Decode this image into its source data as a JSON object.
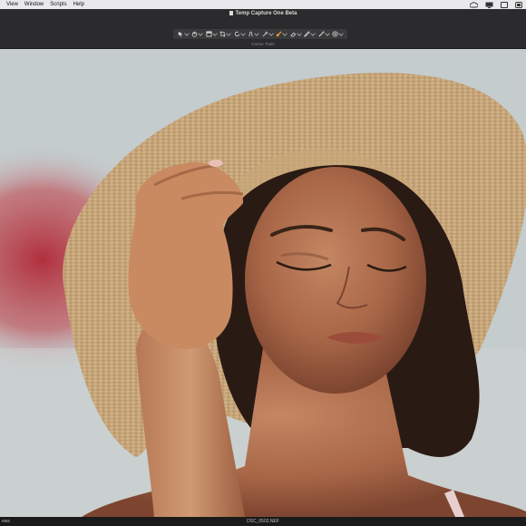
{
  "menu": {
    "items": [
      "View",
      "Window",
      "Scripts",
      "Help"
    ]
  },
  "window": {
    "title": "Temp Capture One Beta"
  },
  "toolbar": {
    "label": "Cursor Tools",
    "tools": [
      "pointer-tool-icon",
      "pan-tool-icon",
      "loupe-tool-icon",
      "crop-tool-icon",
      "rotate-tool-icon",
      "keystone-tool-icon",
      "picker-tool-icon",
      "brush-tool-icon",
      "eraser-tool-icon",
      "draw-mask-icon",
      "pen-tool-icon",
      "annotate-tool-icon"
    ]
  },
  "viewer": {
    "filename": "DSC_0502.NEF",
    "left_fragment": "ews"
  },
  "colors": {
    "accent": "#f0a030",
    "chrome": "#2b2b2d",
    "menubar": "#e9e9ec"
  }
}
